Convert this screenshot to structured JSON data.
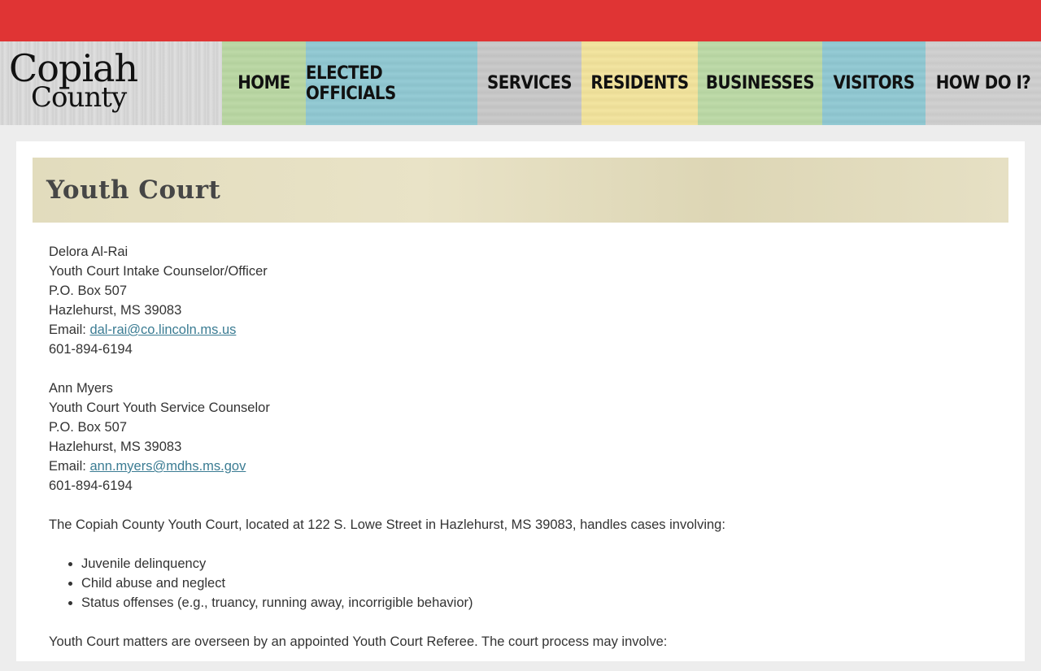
{
  "logo": {
    "line1": "Copiah",
    "line2": "County"
  },
  "nav": [
    {
      "label": "HOME",
      "color": "#b9d7a2"
    },
    {
      "label": "ELECTED OFFICIALS",
      "color": "#8fc8d2"
    },
    {
      "label": "SERVICES",
      "color": "#c8c8c8"
    },
    {
      "label": "RESIDENTS",
      "color": "#f2e39b"
    },
    {
      "label": "BUSINESSES",
      "color": "#bbd9a5"
    },
    {
      "label": "VISITORS",
      "color": "#8fc8d2"
    },
    {
      "label": "HOW DO I?",
      "color": "#cfcfcf"
    }
  ],
  "page": {
    "title": "Youth Court"
  },
  "contacts": [
    {
      "name": "Delora Al-Rai",
      "role": "Youth Court Intake Counselor/Officer",
      "po_box": "P.O. Box 507",
      "city": "Hazlehurst, MS 39083",
      "email_label": "Email: ",
      "email": "dal-rai@co.lincoln.ms.us",
      "phone": "601-894-6194"
    },
    {
      "name": "Ann Myers",
      "role": "Youth Court Youth Service Counselor",
      "po_box": "P.O. Box 507",
      "city": "Hazlehurst, MS 39083",
      "email_label": "Email: ",
      "email": "ann.myers@mdhs.ms.gov",
      "phone": "601-894-6194"
    }
  ],
  "intro": "The Copiah County Youth Court, located at 122 S. Lowe Street in Hazlehurst, MS 39083, handles cases involving:",
  "cases": [
    "Juvenile delinquency",
    "Child abuse and neglect",
    "Status offenses (e.g., truancy, running away, incorrigible behavior)"
  ],
  "outro": "Youth Court matters are overseen by an appointed Youth Court Referee. The court process may involve:",
  "colors": {
    "topbar": "#e03434",
    "link": "#3b7c93"
  }
}
